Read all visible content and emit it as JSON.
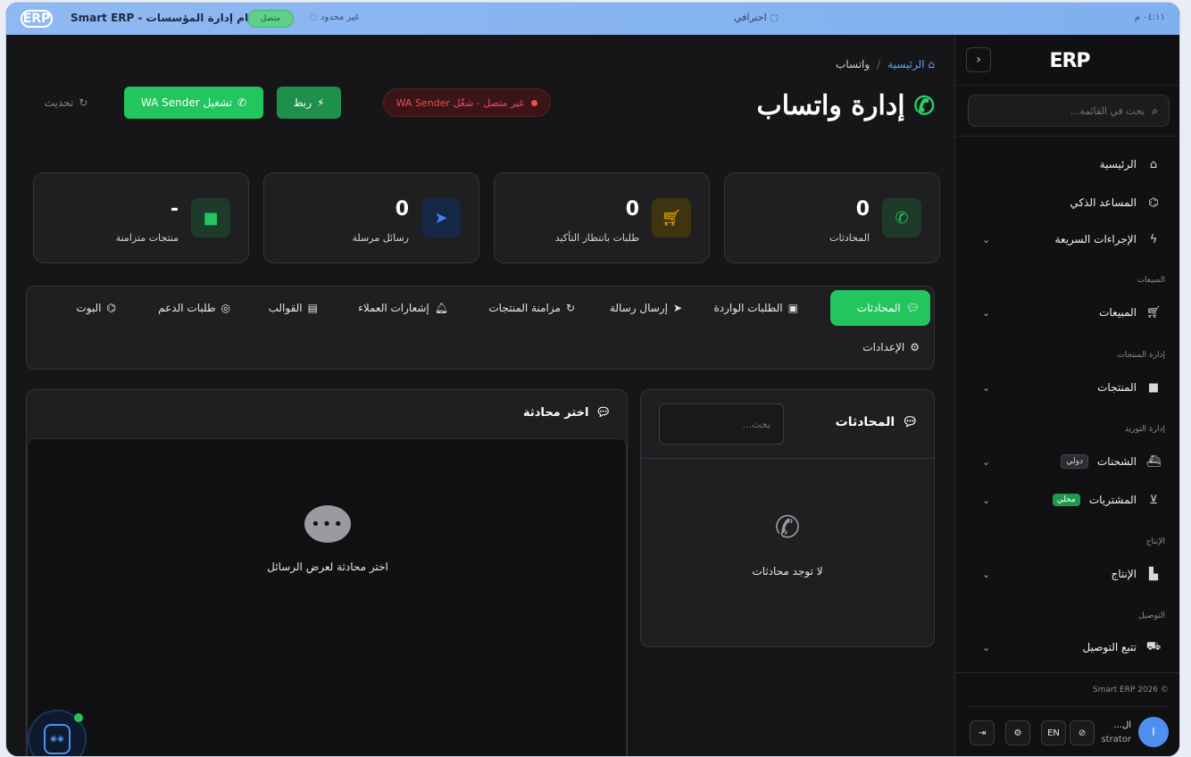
{
  "topbar": {
    "logo": "ERP",
    "title": "Smart ERP - نظام إدارة المؤسسات",
    "status": "متصل",
    "plan": "غير محدود",
    "center": "احترافي",
    "time": "٠٤:١١ م"
  },
  "sidebar": {
    "logo": "ERP",
    "collapse_icon": "chevron-left-icon",
    "search_placeholder": "بحث في القائمة...",
    "items": {
      "home": "الرئيسية",
      "assistant": "المساعد الذكي",
      "quick": "الإجراءات السريعة",
      "sales": "المبيعات",
      "products": "المنتجات",
      "shipments": "الشحنات",
      "shipments_badge": "دولي",
      "purchases": "المشتريات",
      "purchases_badge": "محلي",
      "production": "الإنتاج",
      "delivery": "تتبع التوصيل"
    },
    "sections": {
      "sales": "المبيعات",
      "products": "إدارة المنتجات",
      "supply": "إدارة التوريد",
      "production": "الإنتاج",
      "delivery": "التوصيل"
    },
    "footer": "Smart ERP 2026 ©",
    "user": {
      "initial": "I",
      "name": "ال...",
      "role": "strator"
    },
    "lang_button": "EN"
  },
  "main": {
    "breadcrumb": {
      "home": "الرئيسية",
      "separator": "/",
      "current": "واتساب"
    },
    "title": "إدارة واتساب",
    "connection_status": "غير متصل - شغّل WA Sender",
    "link_button": "ربط",
    "start_button": "تشغيل WA Sender",
    "refresh_button": "تحديث",
    "stats": [
      {
        "value": "0",
        "label": "المحادثات",
        "icon": "whatsapp-icon",
        "color": "#22c55e",
        "bg": "#1d3a2a"
      },
      {
        "value": "0",
        "label": "طلبات بانتظار التأكيد",
        "icon": "cart-icon",
        "color": "#f5b400",
        "bg": "#3f3410"
      },
      {
        "value": "0",
        "label": "رسائل مرسلة",
        "icon": "send-icon",
        "color": "#3b82f6",
        "bg": "#152744"
      },
      {
        "value": "-",
        "label": "منتجات متزامنة",
        "icon": "box-icon",
        "color": "#22c55e",
        "bg": "#1d3a2a"
      }
    ],
    "tabs": {
      "conversations": "المحادثات",
      "incoming_orders": "الطلبات الواردة",
      "send_message": "إرسال رسالة",
      "product_sync": "مزامنة المنتجات",
      "customer_notifications": "إشعارات العملاء",
      "templates": "القوالب",
      "support_requests": "طلبات الدعم",
      "bot": "البوت",
      "settings": "الإعدادات"
    },
    "conversations_panel": {
      "title": "المحادثات",
      "search_placeholder": "بحث...",
      "empty_text": "لا توجد محادثات"
    },
    "chat_panel": {
      "title": "اختر محادثة",
      "empty_text": "اختر محادثة لعرض الرسائل"
    }
  }
}
